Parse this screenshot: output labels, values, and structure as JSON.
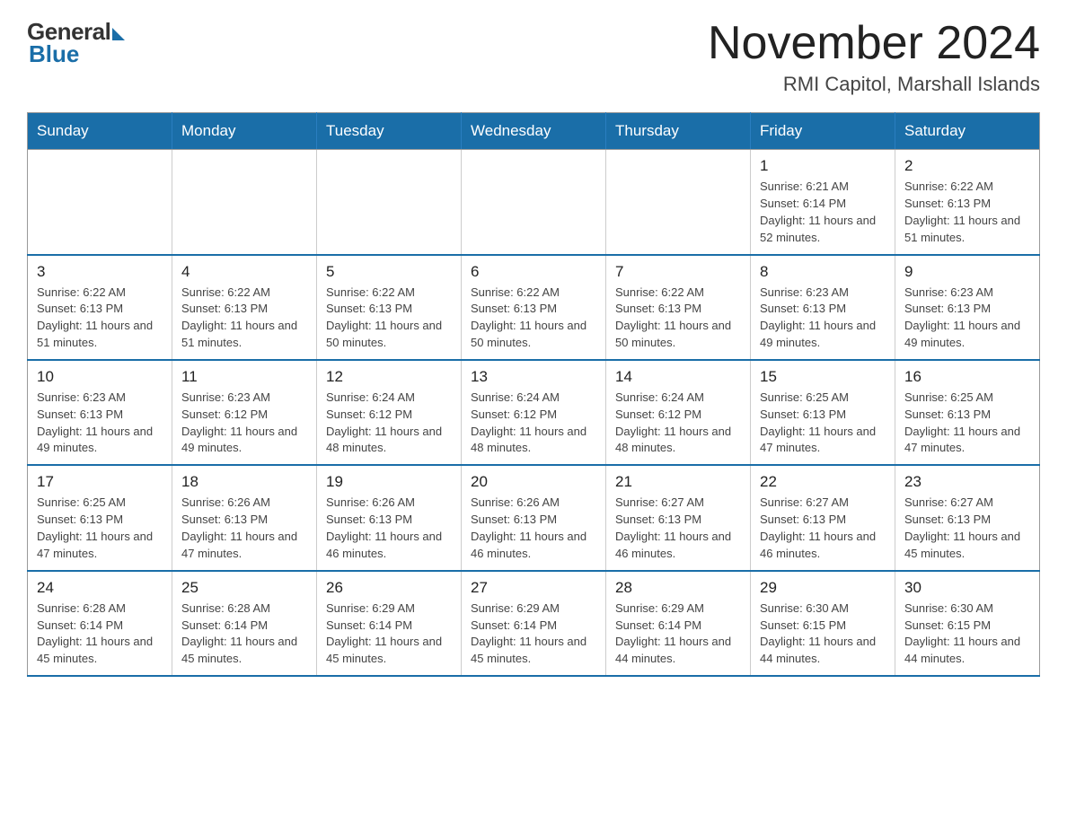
{
  "logo": {
    "general": "General",
    "blue": "Blue"
  },
  "header": {
    "month": "November 2024",
    "location": "RMI Capitol, Marshall Islands"
  },
  "days_of_week": [
    "Sunday",
    "Monday",
    "Tuesday",
    "Wednesday",
    "Thursday",
    "Friday",
    "Saturday"
  ],
  "weeks": [
    [
      {
        "day": "",
        "info": ""
      },
      {
        "day": "",
        "info": ""
      },
      {
        "day": "",
        "info": ""
      },
      {
        "day": "",
        "info": ""
      },
      {
        "day": "",
        "info": ""
      },
      {
        "day": "1",
        "info": "Sunrise: 6:21 AM\nSunset: 6:14 PM\nDaylight: 11 hours and 52 minutes."
      },
      {
        "day": "2",
        "info": "Sunrise: 6:22 AM\nSunset: 6:13 PM\nDaylight: 11 hours and 51 minutes."
      }
    ],
    [
      {
        "day": "3",
        "info": "Sunrise: 6:22 AM\nSunset: 6:13 PM\nDaylight: 11 hours and 51 minutes."
      },
      {
        "day": "4",
        "info": "Sunrise: 6:22 AM\nSunset: 6:13 PM\nDaylight: 11 hours and 51 minutes."
      },
      {
        "day": "5",
        "info": "Sunrise: 6:22 AM\nSunset: 6:13 PM\nDaylight: 11 hours and 50 minutes."
      },
      {
        "day": "6",
        "info": "Sunrise: 6:22 AM\nSunset: 6:13 PM\nDaylight: 11 hours and 50 minutes."
      },
      {
        "day": "7",
        "info": "Sunrise: 6:22 AM\nSunset: 6:13 PM\nDaylight: 11 hours and 50 minutes."
      },
      {
        "day": "8",
        "info": "Sunrise: 6:23 AM\nSunset: 6:13 PM\nDaylight: 11 hours and 49 minutes."
      },
      {
        "day": "9",
        "info": "Sunrise: 6:23 AM\nSunset: 6:13 PM\nDaylight: 11 hours and 49 minutes."
      }
    ],
    [
      {
        "day": "10",
        "info": "Sunrise: 6:23 AM\nSunset: 6:13 PM\nDaylight: 11 hours and 49 minutes."
      },
      {
        "day": "11",
        "info": "Sunrise: 6:23 AM\nSunset: 6:12 PM\nDaylight: 11 hours and 49 minutes."
      },
      {
        "day": "12",
        "info": "Sunrise: 6:24 AM\nSunset: 6:12 PM\nDaylight: 11 hours and 48 minutes."
      },
      {
        "day": "13",
        "info": "Sunrise: 6:24 AM\nSunset: 6:12 PM\nDaylight: 11 hours and 48 minutes."
      },
      {
        "day": "14",
        "info": "Sunrise: 6:24 AM\nSunset: 6:12 PM\nDaylight: 11 hours and 48 minutes."
      },
      {
        "day": "15",
        "info": "Sunrise: 6:25 AM\nSunset: 6:13 PM\nDaylight: 11 hours and 47 minutes."
      },
      {
        "day": "16",
        "info": "Sunrise: 6:25 AM\nSunset: 6:13 PM\nDaylight: 11 hours and 47 minutes."
      }
    ],
    [
      {
        "day": "17",
        "info": "Sunrise: 6:25 AM\nSunset: 6:13 PM\nDaylight: 11 hours and 47 minutes."
      },
      {
        "day": "18",
        "info": "Sunrise: 6:26 AM\nSunset: 6:13 PM\nDaylight: 11 hours and 47 minutes."
      },
      {
        "day": "19",
        "info": "Sunrise: 6:26 AM\nSunset: 6:13 PM\nDaylight: 11 hours and 46 minutes."
      },
      {
        "day": "20",
        "info": "Sunrise: 6:26 AM\nSunset: 6:13 PM\nDaylight: 11 hours and 46 minutes."
      },
      {
        "day": "21",
        "info": "Sunrise: 6:27 AM\nSunset: 6:13 PM\nDaylight: 11 hours and 46 minutes."
      },
      {
        "day": "22",
        "info": "Sunrise: 6:27 AM\nSunset: 6:13 PM\nDaylight: 11 hours and 46 minutes."
      },
      {
        "day": "23",
        "info": "Sunrise: 6:27 AM\nSunset: 6:13 PM\nDaylight: 11 hours and 45 minutes."
      }
    ],
    [
      {
        "day": "24",
        "info": "Sunrise: 6:28 AM\nSunset: 6:14 PM\nDaylight: 11 hours and 45 minutes."
      },
      {
        "day": "25",
        "info": "Sunrise: 6:28 AM\nSunset: 6:14 PM\nDaylight: 11 hours and 45 minutes."
      },
      {
        "day": "26",
        "info": "Sunrise: 6:29 AM\nSunset: 6:14 PM\nDaylight: 11 hours and 45 minutes."
      },
      {
        "day": "27",
        "info": "Sunrise: 6:29 AM\nSunset: 6:14 PM\nDaylight: 11 hours and 45 minutes."
      },
      {
        "day": "28",
        "info": "Sunrise: 6:29 AM\nSunset: 6:14 PM\nDaylight: 11 hours and 44 minutes."
      },
      {
        "day": "29",
        "info": "Sunrise: 6:30 AM\nSunset: 6:15 PM\nDaylight: 11 hours and 44 minutes."
      },
      {
        "day": "30",
        "info": "Sunrise: 6:30 AM\nSunset: 6:15 PM\nDaylight: 11 hours and 44 minutes."
      }
    ]
  ]
}
